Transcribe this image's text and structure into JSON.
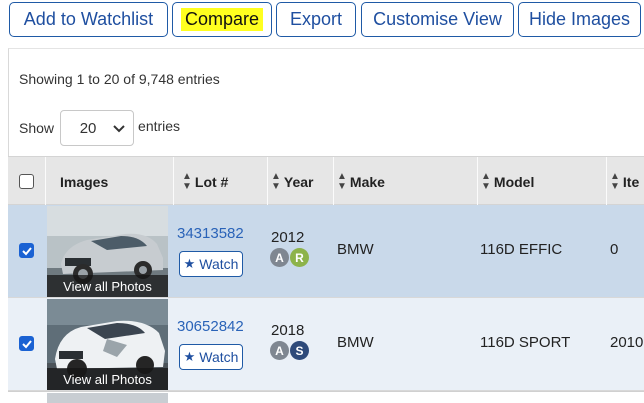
{
  "toolbar": {
    "add_watchlist": "Add to Watchlist",
    "compare": "Compare",
    "export": "Export",
    "customise": "Customise View",
    "hide_images": "Hide Images"
  },
  "summary": "Showing 1 to 20 of 9,748 entries",
  "page_size": {
    "prefix": "Show",
    "value": "20",
    "suffix": "entries"
  },
  "columns": {
    "images": "Images",
    "lot": "Lot #",
    "year": "Year",
    "make": "Make",
    "model": "Model",
    "item": "Ite"
  },
  "rows": [
    {
      "lot": "34313582",
      "watch": "Watch",
      "year": "2012",
      "badges": [
        "A",
        "R"
      ],
      "badge_colors": [
        "#7f8791",
        "#8db34a"
      ],
      "make": "BMW",
      "model": "116D EFFIC",
      "item": "0",
      "photos_label": "View all Photos",
      "checked": true
    },
    {
      "lot": "30652842",
      "watch": "Watch",
      "year": "2018",
      "badges": [
        "A",
        "S"
      ],
      "badge_colors": [
        "#7f8791",
        "#2e4a7a"
      ],
      "make": "BMW",
      "model": "116D SPORT",
      "item": "2010",
      "photos_label": "View all Photos",
      "checked": true
    }
  ],
  "colors": {
    "accent": "#1f5aa6",
    "highlight": "#ffff1f",
    "row_selected": "#c9d9ea",
    "row_alt": "#eaf0f7",
    "header_bg": "#e6e6e6",
    "link": "#2a63b8"
  },
  "icons": {
    "watch": "star-icon",
    "sort": "sort-icon",
    "dropdown": "chevron-down-icon"
  }
}
